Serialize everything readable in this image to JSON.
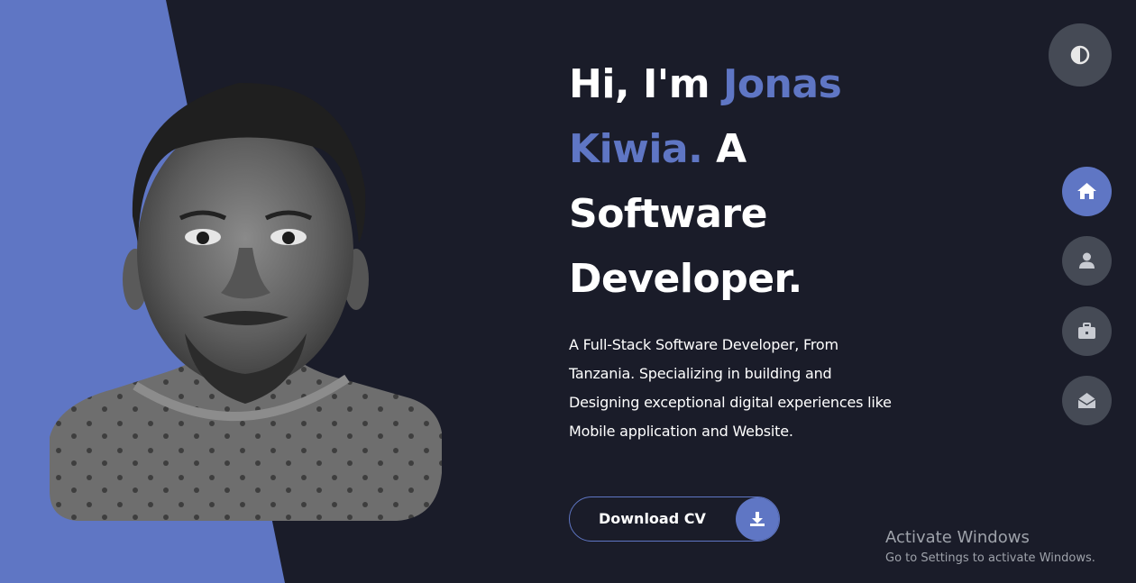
{
  "colors": {
    "background": "#1a1c29",
    "accent": "#5f76c4",
    "nav_button": "#454a55",
    "text": "#ffffff",
    "watermark": "#9ea2aa"
  },
  "hero": {
    "greeting": "Hi, I'm ",
    "name": "Jonas Kiwia.",
    "role": " A Software Developer.",
    "description": "A Full-Stack Software Developer, From Tanzania. Specializing in building and Designing exceptional digital experiences like Mobile application and Website."
  },
  "cv_button": {
    "label": "Download CV",
    "icon": "download-icon"
  },
  "theme_toggle": {
    "icon": "contrast-icon"
  },
  "side_nav": [
    {
      "icon": "home-icon",
      "active": true
    },
    {
      "icon": "user-icon",
      "active": false
    },
    {
      "icon": "briefcase-icon",
      "active": false
    },
    {
      "icon": "envelope-open-icon",
      "active": false
    }
  ],
  "watermark": {
    "title": "Activate Windows",
    "subtitle": "Go to Settings to activate Windows."
  }
}
